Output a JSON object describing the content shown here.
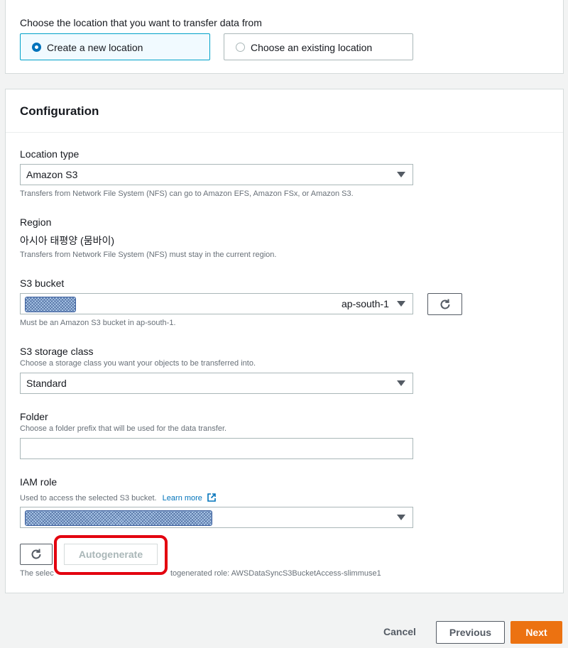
{
  "source": {
    "prompt": "Choose the location that you want to transfer data from",
    "options": [
      {
        "label": "Create a new location",
        "selected": true
      },
      {
        "label": "Choose an existing location",
        "selected": false
      }
    ]
  },
  "config": {
    "title": "Configuration",
    "location_type": {
      "label": "Location type",
      "value": "Amazon S3",
      "hint": "Transfers from Network File System (NFS) can go to Amazon EFS, Amazon FSx, or Amazon S3."
    },
    "region": {
      "label": "Region",
      "value": "아시아 태평양 (뭄바이)",
      "hint": "Transfers from Network File System (NFS) must stay in the current region."
    },
    "s3_bucket": {
      "label": "S3 bucket",
      "region_tag": "ap-south-1",
      "hint": "Must be an Amazon S3 bucket in ap-south-1."
    },
    "storage_class": {
      "label": "S3 storage class",
      "description": "Choose a storage class you want your objects to be transferred into.",
      "value": "Standard"
    },
    "folder": {
      "label": "Folder",
      "description": "Choose a folder prefix that will be used for the data transfer.",
      "value": ""
    },
    "iam_role": {
      "label": "IAM role",
      "description": "Used to access the selected S3 bucket.",
      "learn_more": "Learn more",
      "autogenerate_label": "Autogenerate",
      "footer_left": "The selec",
      "footer_right": "togenerated role: AWSDataSyncS3BucketAccess-slimmuse1"
    }
  },
  "footer": {
    "cancel": "Cancel",
    "previous": "Previous",
    "next": "Next"
  },
  "colors": {
    "primary": "#ec7211",
    "link": "#0073bb",
    "highlight": "#e3000f"
  }
}
